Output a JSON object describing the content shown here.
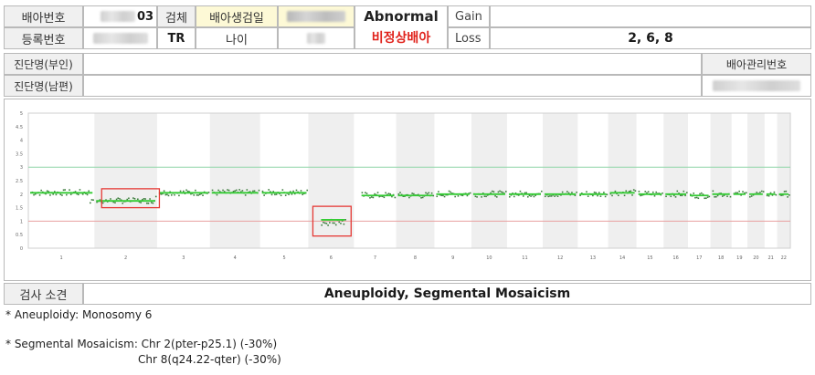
{
  "header": {
    "embryo_no_label": "배아번호",
    "embryo_no_suffix": "03",
    "specimen_label": "검체",
    "biopsy_date_label": "배아생검일",
    "reg_no_label": "등록번호",
    "specimen_value": "TR",
    "age_label": "나이",
    "result_en": "Abnormal",
    "result_ko": "비정상배아",
    "gain_label": "Gain",
    "gain_value": "",
    "loss_label": "Loss",
    "loss_value": "2, 6, 8"
  },
  "diagnosis": {
    "wife_label": "진단명(부인)",
    "husband_label": "진단명(남편)",
    "embryo_mgmt_label": "배아관리번호"
  },
  "chart_data": {
    "type": "scatter",
    "y_ticks": [
      "5",
      "4.5",
      "4",
      "3.5",
      "3",
      "2.5",
      "2",
      "1.5",
      "1",
      "0.5",
      "0"
    ],
    "ylim": [
      0,
      5
    ],
    "reference_lines": [
      {
        "value": 3,
        "color": "#8fd6a8"
      },
      {
        "value": 1,
        "color": "#e8a0a0"
      }
    ],
    "chromosomes": [
      "1",
      "2",
      "3",
      "4",
      "5",
      "6",
      "7",
      "8",
      "9",
      "10",
      "11",
      "12",
      "13",
      "14",
      "15",
      "16",
      "17",
      "18",
      "19",
      "20",
      "21",
      "22"
    ],
    "x_tick_labels": [
      "1",
      "2",
      "3",
      "4",
      "5",
      "6",
      "7",
      "8",
      "9",
      "10",
      "11",
      "12",
      "13",
      "14",
      "15",
      "16",
      "17",
      "18",
      "19",
      "20",
      "21",
      "22"
    ],
    "copy_numbers": [
      2.05,
      2.0,
      2.05,
      2.05,
      2.05,
      1.05,
      1.95,
      1.95,
      2.0,
      2.0,
      2.0,
      2.0,
      2.0,
      2.05,
      2.0,
      2.0,
      1.95,
      2.0,
      2.0,
      2.0,
      2.0,
      2.0
    ],
    "segment_calls": [
      {
        "chromosome": "2",
        "value": 1.75
      },
      {
        "chromosome": "6",
        "value": 1.05
      }
    ],
    "point_color": "#3f7d3f",
    "call_line_color": "#33cc33",
    "highlight_color": "#e53935"
  },
  "findings": {
    "label": "검사 소견",
    "summary": "Aneuploidy, Segmental Mosaicism",
    "line1": "* Aneuploidy: Monosomy 6",
    "line2": "* Segmental Mosaicism: Chr 2(pter-p25.1) (-30%)",
    "line3": "Chr 8(q24.22-qter) (-30%)"
  }
}
